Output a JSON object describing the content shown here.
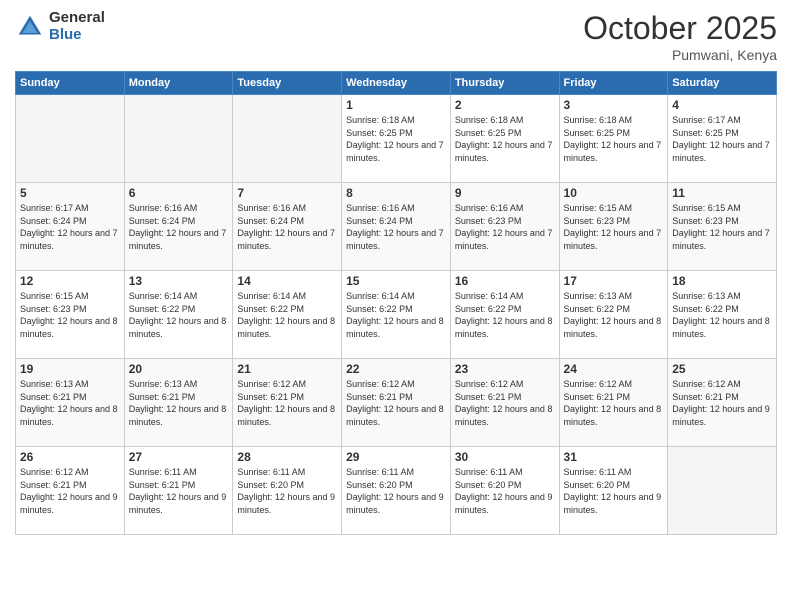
{
  "header": {
    "logo_general": "General",
    "logo_blue": "Blue",
    "month_title": "October 2025",
    "location": "Pumwani, Kenya"
  },
  "days_of_week": [
    "Sunday",
    "Monday",
    "Tuesday",
    "Wednesday",
    "Thursday",
    "Friday",
    "Saturday"
  ],
  "weeks": [
    [
      {
        "day": "",
        "info": ""
      },
      {
        "day": "",
        "info": ""
      },
      {
        "day": "",
        "info": ""
      },
      {
        "day": "1",
        "info": "Sunrise: 6:18 AM\nSunset: 6:25 PM\nDaylight: 12 hours\nand 7 minutes."
      },
      {
        "day": "2",
        "info": "Sunrise: 6:18 AM\nSunset: 6:25 PM\nDaylight: 12 hours\nand 7 minutes."
      },
      {
        "day": "3",
        "info": "Sunrise: 6:18 AM\nSunset: 6:25 PM\nDaylight: 12 hours\nand 7 minutes."
      },
      {
        "day": "4",
        "info": "Sunrise: 6:17 AM\nSunset: 6:25 PM\nDaylight: 12 hours\nand 7 minutes."
      }
    ],
    [
      {
        "day": "5",
        "info": "Sunrise: 6:17 AM\nSunset: 6:24 PM\nDaylight: 12 hours\nand 7 minutes."
      },
      {
        "day": "6",
        "info": "Sunrise: 6:16 AM\nSunset: 6:24 PM\nDaylight: 12 hours\nand 7 minutes."
      },
      {
        "day": "7",
        "info": "Sunrise: 6:16 AM\nSunset: 6:24 PM\nDaylight: 12 hours\nand 7 minutes."
      },
      {
        "day": "8",
        "info": "Sunrise: 6:16 AM\nSunset: 6:24 PM\nDaylight: 12 hours\nand 7 minutes."
      },
      {
        "day": "9",
        "info": "Sunrise: 6:16 AM\nSunset: 6:23 PM\nDaylight: 12 hours\nand 7 minutes."
      },
      {
        "day": "10",
        "info": "Sunrise: 6:15 AM\nSunset: 6:23 PM\nDaylight: 12 hours\nand 7 minutes."
      },
      {
        "day": "11",
        "info": "Sunrise: 6:15 AM\nSunset: 6:23 PM\nDaylight: 12 hours\nand 7 minutes."
      }
    ],
    [
      {
        "day": "12",
        "info": "Sunrise: 6:15 AM\nSunset: 6:23 PM\nDaylight: 12 hours\nand 8 minutes."
      },
      {
        "day": "13",
        "info": "Sunrise: 6:14 AM\nSunset: 6:22 PM\nDaylight: 12 hours\nand 8 minutes."
      },
      {
        "day": "14",
        "info": "Sunrise: 6:14 AM\nSunset: 6:22 PM\nDaylight: 12 hours\nand 8 minutes."
      },
      {
        "day": "15",
        "info": "Sunrise: 6:14 AM\nSunset: 6:22 PM\nDaylight: 12 hours\nand 8 minutes."
      },
      {
        "day": "16",
        "info": "Sunrise: 6:14 AM\nSunset: 6:22 PM\nDaylight: 12 hours\nand 8 minutes."
      },
      {
        "day": "17",
        "info": "Sunrise: 6:13 AM\nSunset: 6:22 PM\nDaylight: 12 hours\nand 8 minutes."
      },
      {
        "day": "18",
        "info": "Sunrise: 6:13 AM\nSunset: 6:22 PM\nDaylight: 12 hours\nand 8 minutes."
      }
    ],
    [
      {
        "day": "19",
        "info": "Sunrise: 6:13 AM\nSunset: 6:21 PM\nDaylight: 12 hours\nand 8 minutes."
      },
      {
        "day": "20",
        "info": "Sunrise: 6:13 AM\nSunset: 6:21 PM\nDaylight: 12 hours\nand 8 minutes."
      },
      {
        "day": "21",
        "info": "Sunrise: 6:12 AM\nSunset: 6:21 PM\nDaylight: 12 hours\nand 8 minutes."
      },
      {
        "day": "22",
        "info": "Sunrise: 6:12 AM\nSunset: 6:21 PM\nDaylight: 12 hours\nand 8 minutes."
      },
      {
        "day": "23",
        "info": "Sunrise: 6:12 AM\nSunset: 6:21 PM\nDaylight: 12 hours\nand 8 minutes."
      },
      {
        "day": "24",
        "info": "Sunrise: 6:12 AM\nSunset: 6:21 PM\nDaylight: 12 hours\nand 8 minutes."
      },
      {
        "day": "25",
        "info": "Sunrise: 6:12 AM\nSunset: 6:21 PM\nDaylight: 12 hours\nand 9 minutes."
      }
    ],
    [
      {
        "day": "26",
        "info": "Sunrise: 6:12 AM\nSunset: 6:21 PM\nDaylight: 12 hours\nand 9 minutes."
      },
      {
        "day": "27",
        "info": "Sunrise: 6:11 AM\nSunset: 6:21 PM\nDaylight: 12 hours\nand 9 minutes."
      },
      {
        "day": "28",
        "info": "Sunrise: 6:11 AM\nSunset: 6:20 PM\nDaylight: 12 hours\nand 9 minutes."
      },
      {
        "day": "29",
        "info": "Sunrise: 6:11 AM\nSunset: 6:20 PM\nDaylight: 12 hours\nand 9 minutes."
      },
      {
        "day": "30",
        "info": "Sunrise: 6:11 AM\nSunset: 6:20 PM\nDaylight: 12 hours\nand 9 minutes."
      },
      {
        "day": "31",
        "info": "Sunrise: 6:11 AM\nSunset: 6:20 PM\nDaylight: 12 hours\nand 9 minutes."
      },
      {
        "day": "",
        "info": ""
      }
    ]
  ]
}
